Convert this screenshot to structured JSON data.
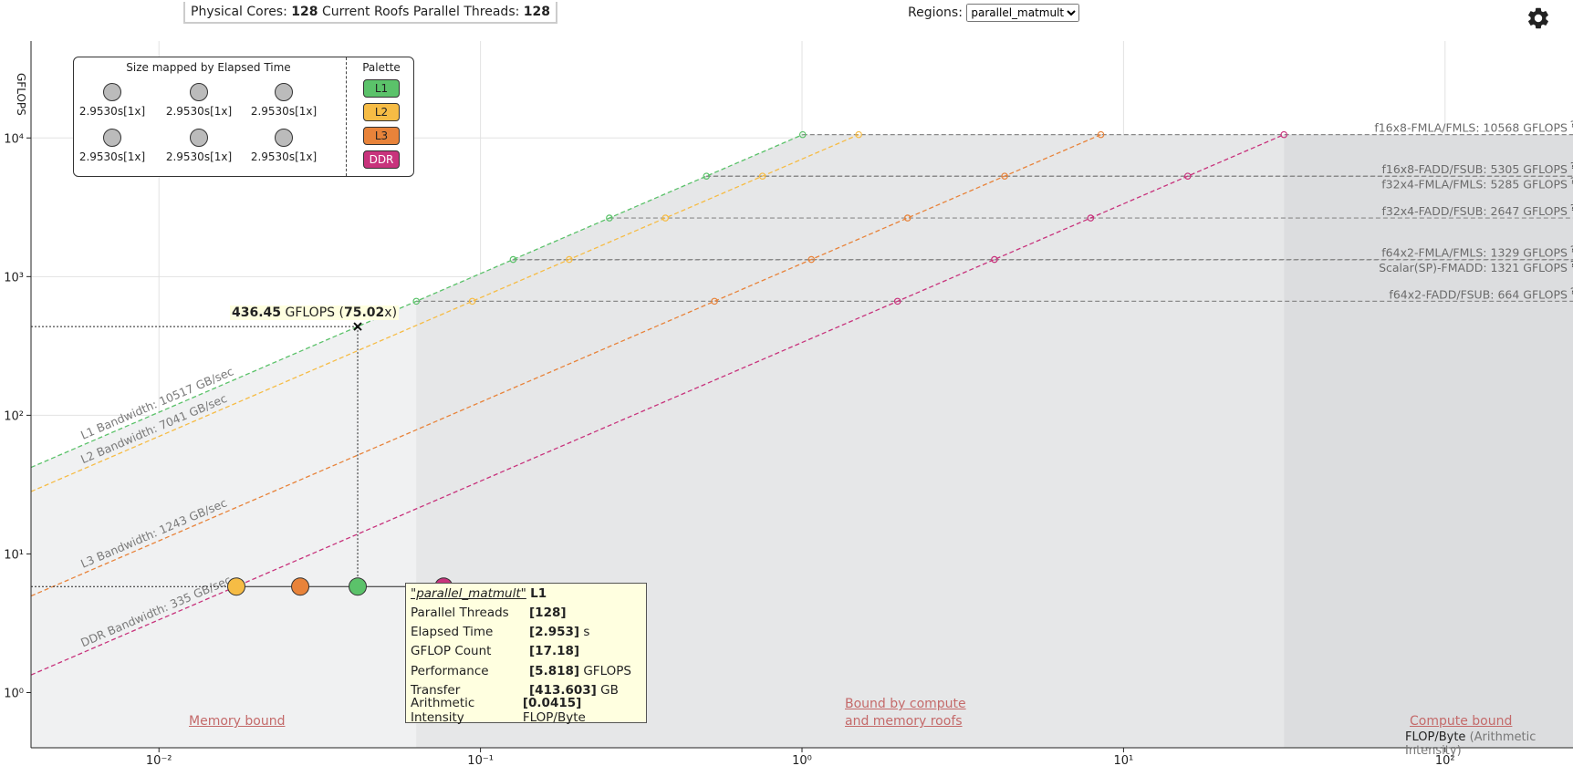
{
  "header": {
    "physical_cores_label": "Physical Cores:",
    "physical_cores": "128",
    "threads_label": "Current Roofs Parallel Threads:",
    "threads": "128",
    "regions_label": "Regions:",
    "regions_selected": "parallel_matmult"
  },
  "legend": {
    "title": "Size mapped by Elapsed Time",
    "cells": [
      "2.9530s[1x]",
      "2.9530s[1x]",
      "2.9530s[1x]",
      "2.9530s[1x]",
      "2.9530s[1x]",
      "2.9530s[1x]"
    ],
    "palette_title": "Palette",
    "palette": [
      {
        "label": "L1",
        "color": "#5bc26a"
      },
      {
        "label": "L2",
        "color": "#f6bc45"
      },
      {
        "label": "L3",
        "color": "#e8833a"
      },
      {
        "label": "DDR",
        "color": "#c8337c"
      }
    ]
  },
  "tooltip": {
    "region": "\"parallel_matmult\"",
    "level": "L1",
    "rows": [
      {
        "key": "Parallel Threads",
        "value": "[128]",
        "unit": ""
      },
      {
        "key": "Elapsed Time",
        "value": "[2.953]",
        "unit": " s"
      },
      {
        "key": "GFLOP Count",
        "value": "[17.18]",
        "unit": ""
      },
      {
        "key": "Performance",
        "value": "[5.818]",
        "unit": " GFLOPS"
      },
      {
        "key": "Transfer",
        "value": "[413.603]",
        "unit": " GB"
      },
      {
        "key": "Arithmetic Intensity",
        "value": "[0.0415]",
        "unit": " FLOP/Byte"
      }
    ]
  },
  "perf_marker": {
    "value": "436.45",
    "unit": "GFLOPS",
    "ratio": "75.02",
    "ratio_suffix": "x"
  },
  "zones": {
    "memory": "Memory bound",
    "both_line1": "Bound by compute",
    "both_line2": "and memory roofs",
    "compute": "Compute bound"
  },
  "axis_caption": {
    "main": "FLOP/Byte",
    "paren": "(Arithmetic Intensity)"
  },
  "y_axis_caption": "GFLOPS",
  "chart_data": {
    "type": "scatter",
    "x_scale": "log",
    "y_scale": "log",
    "xlim": [
      0.004,
      250
    ],
    "ylim": [
      0.4,
      50000
    ],
    "x_ticks": [
      {
        "value": 0.01,
        "label": "10⁻²"
      },
      {
        "value": 0.1,
        "label": "10⁻¹"
      },
      {
        "value": 1,
        "label": "10⁰"
      },
      {
        "value": 10,
        "label": "10¹"
      },
      {
        "value": 100,
        "label": "10²"
      }
    ],
    "y_ticks": [
      {
        "value": 1,
        "label": "10⁰"
      },
      {
        "value": 10,
        "label": "10¹"
      },
      {
        "value": 100,
        "label": "10²"
      },
      {
        "value": 1000,
        "label": "10³"
      },
      {
        "value": 10000,
        "label": "10⁴"
      }
    ],
    "memory_roofs": [
      {
        "name": "L1 Bandwidth: 10517 GB/sec",
        "bandwidth": 10517,
        "color": "#5bc26a"
      },
      {
        "name": "L2 Bandwidth: 7041 GB/sec",
        "bandwidth": 7041,
        "color": "#f6bc45"
      },
      {
        "name": "L3 Bandwidth: 1243 GB/sec",
        "bandwidth": 1243,
        "color": "#e8833a"
      },
      {
        "name": "DDR Bandwidth: 335 GB/sec",
        "bandwidth": 335,
        "color": "#c8337c"
      }
    ],
    "compute_roofs": [
      {
        "name": "f16x8-FMLA/FMLS: 10568 GFLOPS",
        "gflops": 10568
      },
      {
        "name": "f16x8-FADD/FSUB: 5305 GFLOPS",
        "gflops": 5305
      },
      {
        "name": "f32x4-FMLA/FMLS: 5285 GFLOPS",
        "gflops": 5285
      },
      {
        "name": "f32x4-FADD/FSUB: 2647 GFLOPS",
        "gflops": 2647
      },
      {
        "name": "f64x2-FMLA/FMLS: 1329 GFLOPS",
        "gflops": 1329
      },
      {
        "name": "Scalar(SP)-FMADD: 1321 GFLOPS",
        "gflops": 1321
      },
      {
        "name": "f64x2-FADD/FSUB: 664 GFLOPS",
        "gflops": 664
      }
    ],
    "points": [
      {
        "level": "L2",
        "ai": 0.0174,
        "gflops": 5.818
      },
      {
        "level": "L3",
        "ai": 0.0275,
        "gflops": 5.818
      },
      {
        "level": "L1",
        "ai": 0.0415,
        "gflops": 5.818
      },
      {
        "level": "DDR",
        "ai": 0.0768,
        "gflops": 5.818
      }
    ],
    "selected_point": {
      "ai": 0.0415,
      "gflops": 5.818,
      "roof_gflops": 436.45
    }
  }
}
